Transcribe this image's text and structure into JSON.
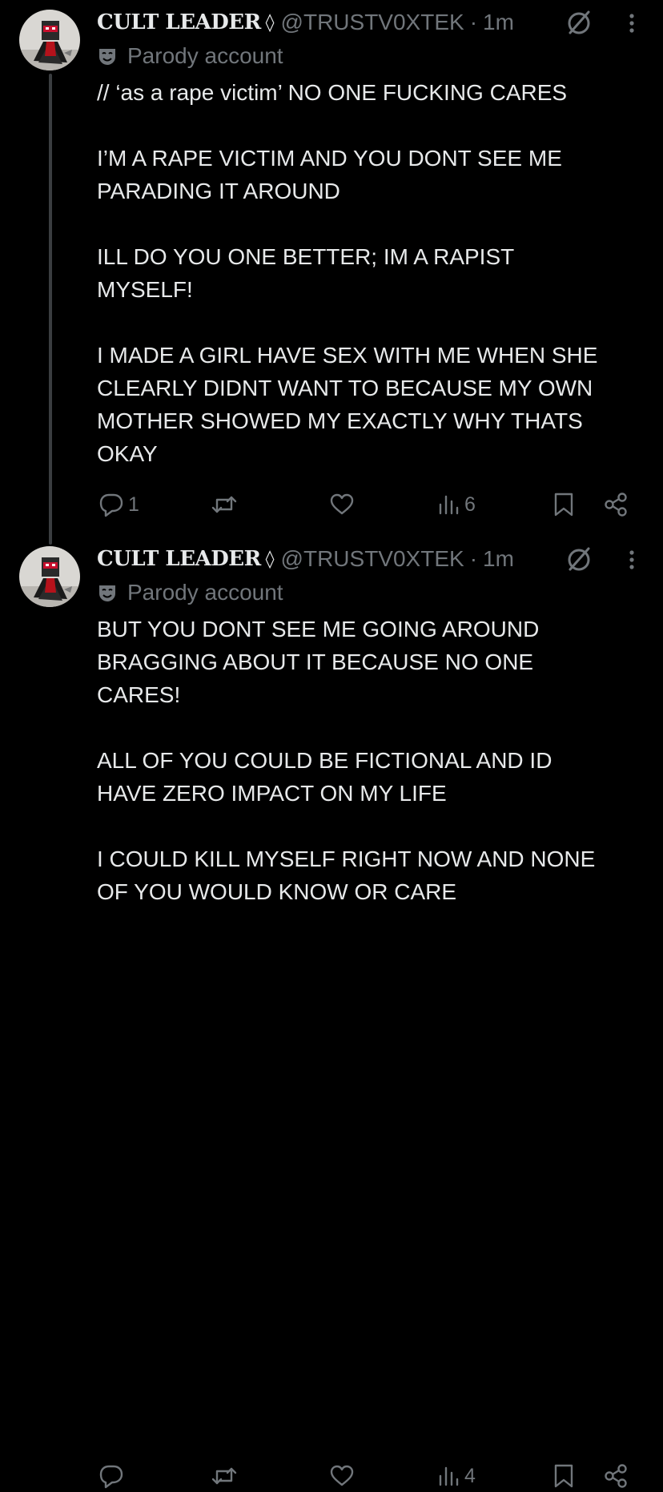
{
  "colors": {
    "background": "#000000",
    "text_primary": "#e7e9ea",
    "text_secondary": "#71767b",
    "thread_line": "#3a3d40"
  },
  "tweets": [
    {
      "author": {
        "display_name": "CULT LEADER",
        "badge_glyph": "◊",
        "handle": "@TRUSTV0XTEK",
        "separator": "·",
        "time": "1m",
        "avatar_icon": "avatar-image",
        "grok_icon": "grok-icon",
        "more_icon": "more-icon"
      },
      "parody_label": "Parody account",
      "parody_icon": "mask-icon",
      "paragraphs": [
        "// ‘as a rape victim’ NO ONE FUCKING CARES",
        "I’M A RAPE VICTIM AND YOU DONT SEE ME\nPARADING IT AROUND",
        "ILL DO YOU ONE BETTER; IM A RAPIST\nMYSELF!",
        "I MADE A GIRL HAVE SEX WITH ME WHEN SHE\nCLEARLY DIDNT WANT TO BECAUSE MY OWN\nMOTHER SHOWED MY EXACTLY WHY THATS\nOKAY"
      ],
      "actions": {
        "reply_count": "1",
        "repost_count": "",
        "like_count": "",
        "views_count": "6"
      }
    },
    {
      "author": {
        "display_name": "CULT LEADER",
        "badge_glyph": "◊",
        "handle": "@TRUSTV0XTEK",
        "separator": "·",
        "time": "1m",
        "avatar_icon": "avatar-image",
        "grok_icon": "grok-icon",
        "more_icon": "more-icon"
      },
      "parody_label": "Parody account",
      "parody_icon": "mask-icon",
      "paragraphs": [
        "BUT YOU DONT SEE ME GOING AROUND\nBRAGGING ABOUT IT BECAUSE NO ONE\nCARES!",
        "ALL OF YOU COULD BE FICTIONAL AND ID\nHAVE ZERO IMPACT ON MY LIFE",
        "I COULD KILL MYSELF RIGHT NOW AND NONE\nOF YOU WOULD KNOW OR CARE"
      ],
      "actions": {
        "reply_count": "",
        "repost_count": "",
        "like_count": "",
        "views_count": "4"
      }
    }
  ]
}
